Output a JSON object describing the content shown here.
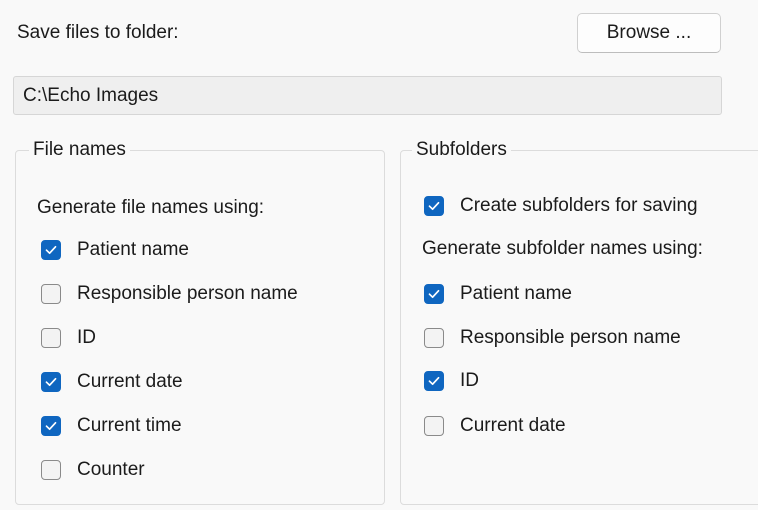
{
  "save": {
    "label": "Save files to folder:",
    "browse_label": "Browse ...",
    "folder_path": "C:\\Echo Images"
  },
  "file_names": {
    "title": "File names",
    "subtitle": "Generate file names using:",
    "options": [
      {
        "label": "Patient name",
        "checked": true
      },
      {
        "label": "Responsible person name",
        "checked": false
      },
      {
        "label": "ID",
        "checked": false
      },
      {
        "label": "Current date",
        "checked": true
      },
      {
        "label": "Current time",
        "checked": true
      },
      {
        "label": "Counter",
        "checked": false
      }
    ]
  },
  "subfolders": {
    "title": "Subfolders",
    "create_label": "Create subfolders for saving",
    "create_checked": true,
    "subtitle": "Generate subfolder names using:",
    "options": [
      {
        "label": "Patient name",
        "checked": true
      },
      {
        "label": "Responsible person name",
        "checked": false
      },
      {
        "label": "ID",
        "checked": true
      },
      {
        "label": "Current date",
        "checked": false
      }
    ]
  },
  "colors": {
    "checkbox_checked": "#0f66c0",
    "checkbox_unchecked_border": "#8a8a8a",
    "panel_background": "#f9f9f9"
  },
  "icons": {
    "check": "checkmark-icon"
  }
}
